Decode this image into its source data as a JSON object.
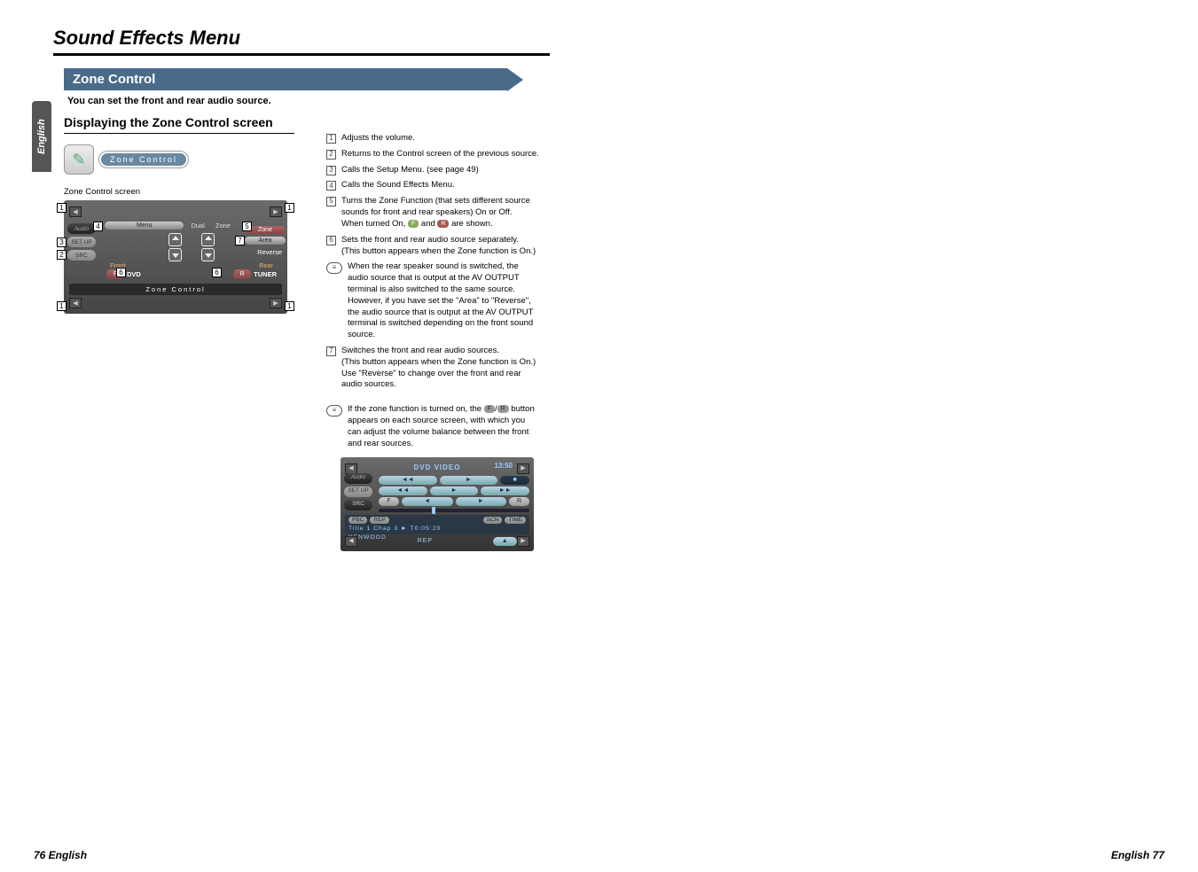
{
  "page": {
    "title": "Sound Effects Menu",
    "lang_tab": "English",
    "footer_left": "76 English",
    "footer_right": "English 77"
  },
  "section": {
    "header": "Zone Control",
    "sub": "You can set the front and rear audio source.",
    "h3": "Displaying the Zone Control screen"
  },
  "pill": {
    "label": "Zone Control"
  },
  "screen1": {
    "caption": "Zone Control screen",
    "side": {
      "audio": "Audio",
      "setup": "SET UP",
      "src": "SRC"
    },
    "menu": "Menu",
    "dual": "Dual",
    "zone_label": "Zone",
    "zone_pill": "Zone",
    "area": "Area",
    "reverse": "Reverse",
    "front": "Front",
    "rear": "Rear",
    "src_f": "F",
    "src_r": "R",
    "src_dvd": "DVD",
    "src_tuner": "TUNER",
    "footer": "Zone Control",
    "nums": {
      "n1": "1",
      "n2": "2",
      "n3": "3",
      "n4": "4",
      "n5": "5",
      "n6": "6",
      "n7": "7"
    }
  },
  "list": {
    "i1": "Adjusts the volume.",
    "i2": "Returns to the Control screen of the previous source.",
    "i3": "Calls the Setup Menu. (see page 49)",
    "i4": "Calls the Sound Effects Menu.",
    "i5a": "Turns the Zone Function (that sets different source sounds for front and rear speakers) On or Off.",
    "i5b_prefix": "When turned On, ",
    "i5b_mid": " and ",
    "i5b_suffix": " are shown.",
    "badge_f": "F",
    "badge_r": "R",
    "i6a": "Sets the front and rear audio source separately.",
    "i6b": "(This button appears when the Zone function is On.)",
    "note6": "When the rear speaker sound is switched, the audio source that is output at the AV OUTPUT terminal is also switched to the same source. However, if you have set the \"Area\" to \"Reverse\", the audio source that is output at the AV OUTPUT terminal is switched depending on the front sound source.",
    "i7a": "Switches the front and rear audio sources.",
    "i7b": "(This button appears when the Zone function is On.)",
    "i7c": "Use \"Reverse\" to change over the front and rear audio sources.",
    "note_fr_prefix": "If the zone function is turned on, the ",
    "note_fr_mid": "/",
    "note_fr_suffix": " button appears on each source screen, with which you can adjust the volume balance between the front and rear sources.",
    "fbtn": "F",
    "rbtn": "R"
  },
  "screen2": {
    "title": "DVD VIDEO",
    "time": "13:50",
    "side": {
      "audio": "Audio",
      "setup": "SET UP",
      "src": "SRC"
    },
    "btns": {
      "prev": "◄◄",
      "rew": "◄◄",
      "play": "►",
      "next": "►►",
      "stop": "►►▌"
    },
    "fr": {
      "f": "F",
      "r": "R"
    },
    "chips": {
      "pbc": "PBC",
      "rep": "REP",
      "scn": "SCN",
      "time": "TIME"
    },
    "info1": "Title 1   Chap   3   ►   T0:05:20",
    "info2": "KENWOOD",
    "footer": "REP"
  }
}
